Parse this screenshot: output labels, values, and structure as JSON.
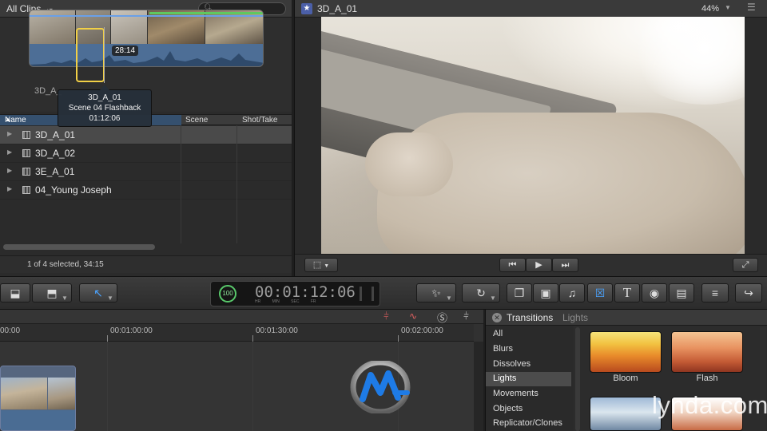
{
  "browser": {
    "library_label": "All Clips",
    "skim_time": "28:14",
    "clip_label_under": "3D_A_",
    "tooltip": {
      "clip": "3D_A_01",
      "scene": "Scene 04 Flashback",
      "time": "01:12:06"
    },
    "columns": {
      "name": "Name",
      "scene": "Scene",
      "shot_take": "Shot/Take"
    },
    "rows": [
      {
        "name": "3D_A_01",
        "selected": true
      },
      {
        "name": "3D_A_02",
        "selected": false
      },
      {
        "name": "3E_A_01",
        "selected": false
      },
      {
        "name": "04_Young Joseph",
        "selected": false
      }
    ],
    "status": "1 of 4 selected, 34:15"
  },
  "viewer": {
    "title": "3D_A_01",
    "zoom": "44%"
  },
  "toolbar": {
    "percent": "100",
    "timecode": "00:01:12:06",
    "timecode_units": "HR MIN SEC FR",
    "colors": {
      "accent": "#4aa3ff",
      "progress": "#58c86a"
    }
  },
  "timeline": {
    "ruler": [
      "00:00",
      "00:01:00:00",
      "00:01:30:00",
      "00:02:00:00"
    ]
  },
  "effects": {
    "title": "Transitions",
    "subtitle": "Lights",
    "categories": [
      {
        "label": "All",
        "selected": false
      },
      {
        "label": "Blurs",
        "selected": false
      },
      {
        "label": "Dissolves",
        "selected": false
      },
      {
        "label": "Lights",
        "selected": true
      },
      {
        "label": "Movements",
        "selected": false
      },
      {
        "label": "Objects",
        "selected": false
      },
      {
        "label": "Replicator/Clones",
        "selected": false
      }
    ],
    "items": [
      {
        "label": "Bloom"
      },
      {
        "label": "Flash"
      }
    ]
  },
  "watermark": {
    "text": "lynda.com"
  }
}
